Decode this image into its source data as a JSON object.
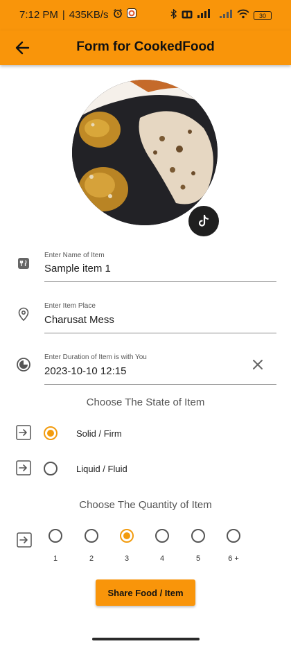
{
  "status_bar": {
    "time": "7:12 PM",
    "data_speed": "435KB/s",
    "battery": "30",
    "bg_color": "#f9950a"
  },
  "app_bar": {
    "title": "Form for CookedFood",
    "back_icon": "arrow-left-icon",
    "bg_color": "#f9950a"
  },
  "photo": {
    "badge_icon": "tiktok-icon"
  },
  "fields": [
    {
      "label": "Enter Name of Item",
      "value": "Sample item 1",
      "icon": "restaurant-icon"
    },
    {
      "label": "Enter Item Place",
      "value": "Charusat Mess",
      "icon": "location-pin-icon"
    },
    {
      "label": "Enter Duration of Item is with You",
      "value": "2023-10-10 12:15",
      "icon": "timelapse-icon",
      "clear_icon": "close-icon"
    }
  ],
  "state_section": {
    "title": "Choose The State of Item",
    "options": [
      {
        "label": "Solid / Firm",
        "selected": true
      },
      {
        "label": "Liquid / Fluid",
        "selected": false
      }
    ]
  },
  "quantity_section": {
    "title": "Choose The Quantity of Item",
    "options": [
      {
        "label": "1",
        "selected": false
      },
      {
        "label": "2",
        "selected": false
      },
      {
        "label": "3",
        "selected": true
      },
      {
        "label": "4",
        "selected": false
      },
      {
        "label": "5",
        "selected": false
      },
      {
        "label": "6 +",
        "selected": false
      }
    ]
  },
  "share_button": {
    "label": "Share Food / Item",
    "bg_color": "#f9950a"
  },
  "accent_color": "#f29b0d"
}
